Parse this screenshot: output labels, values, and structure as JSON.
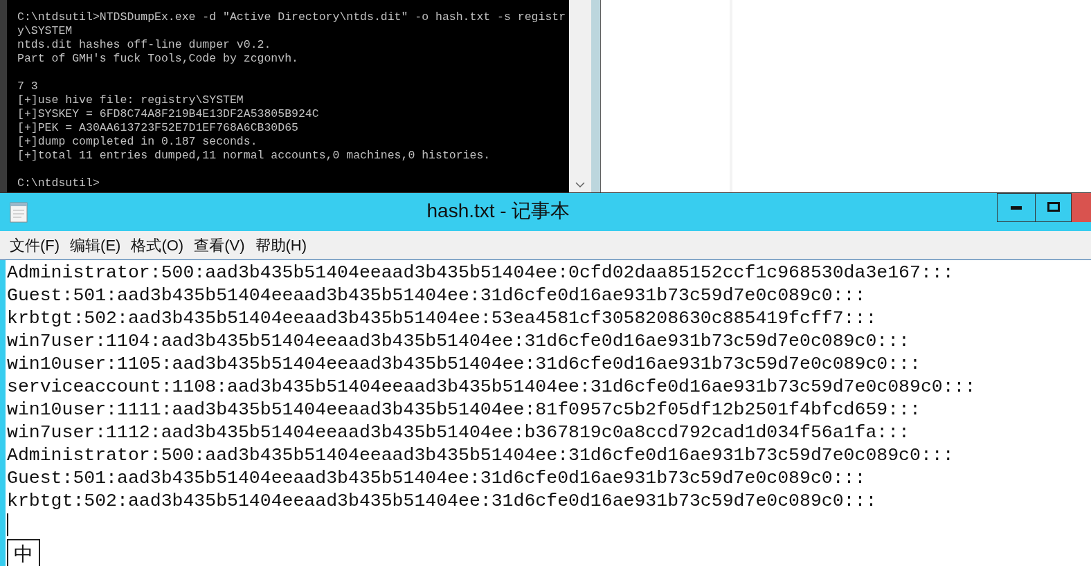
{
  "console": {
    "blocks": [
      [
        "C:\\ntdsutil>NTDSDumpEx.exe -d \"Active Directory\\ntds.dit\" -o hash.txt -s registr",
        "y\\SYSTEM",
        "ntds.dit hashes off-line dumper v0.2.",
        "Part of GMH's fuck Tools,Code by zcgonvh."
      ],
      [
        "7 3",
        "[+]use hive file: registry\\SYSTEM",
        "[+]SYSKEY = 6FD8C74A8F219B4E13DF2A53805B924C",
        "[+]PEK = A30AA613723F52E7D1EF768A6CB30D65",
        "[+]dump completed in 0.187 seconds.",
        "[+]total 11 entries dumped,11 normal accounts,0 machines,0 histories."
      ],
      [
        "C:\\ntdsutil>"
      ]
    ]
  },
  "notepad": {
    "title": "hash.txt - 记事本",
    "menu": [
      "文件(F)",
      "编辑(E)",
      "格式(O)",
      "查看(V)",
      "帮助(H)"
    ],
    "lines": [
      "Administrator:500:aad3b435b51404eeaad3b435b51404ee:0cfd02daa85152ccf1c968530da3e167:::",
      "Guest:501:aad3b435b51404eeaad3b435b51404ee:31d6cfe0d16ae931b73c59d7e0c089c0:::",
      "krbtgt:502:aad3b435b51404eeaad3b435b51404ee:53ea4581cf3058208630c885419fcff7:::",
      "win7user:1104:aad3b435b51404eeaad3b435b51404ee:31d6cfe0d16ae931b73c59d7e0c089c0:::",
      "win10user:1105:aad3b435b51404eeaad3b435b51404ee:31d6cfe0d16ae931b73c59d7e0c089c0:::",
      "serviceaccount:1108:aad3b435b51404eeaad3b435b51404ee:31d6cfe0d16ae931b73c59d7e0c089c0:::",
      "win10user:1111:aad3b435b51404eeaad3b435b51404ee:81f0957c5b2f05df12b2501f4bfcd659:::",
      "win7user:1112:aad3b435b51404eeaad3b435b51404ee:b367819c0a8ccd792cad1d034f56a1fa:::",
      "Administrator:500:aad3b435b51404eeaad3b435b51404ee:31d6cfe0d16ae931b73c59d7e0c089c0:::",
      "Guest:501:aad3b435b51404eeaad3b435b51404ee:31d6cfe0d16ae931b73c59d7e0c089c0:::",
      "krbtgt:502:aad3b435b51404eeaad3b435b51404ee:31d6cfe0d16ae931b73c59d7e0c089c0:::"
    ],
    "ime_indicator": "中"
  }
}
